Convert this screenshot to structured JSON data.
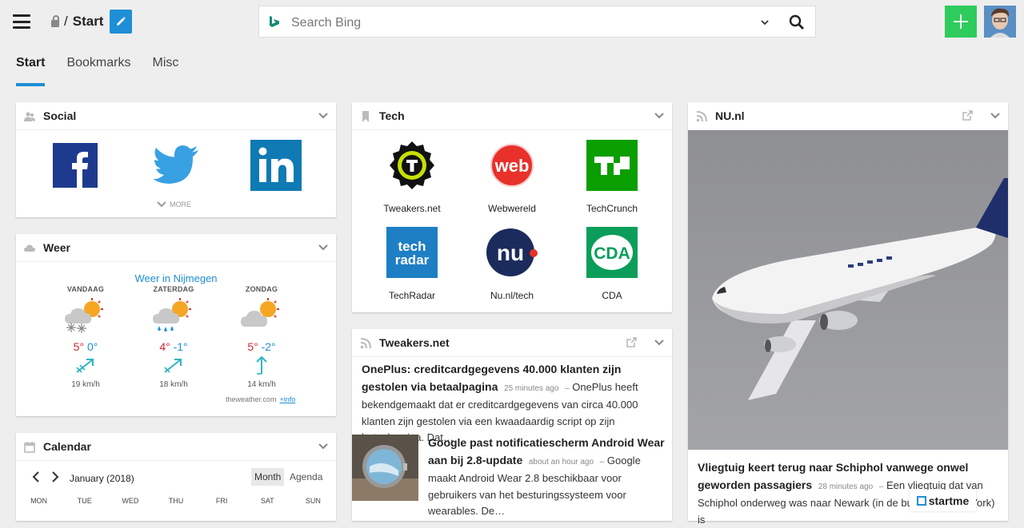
{
  "header": {
    "breadcrumb_sep": "/",
    "page_title": "Start",
    "search_placeholder": "Search Bing"
  },
  "tabs": [
    {
      "label": "Start",
      "active": true
    },
    {
      "label": "Bookmarks",
      "active": false
    },
    {
      "label": "Misc",
      "active": false
    }
  ],
  "social": {
    "title": "Social",
    "icons": [
      "facebook-icon",
      "twitter-icon",
      "linkedin-icon"
    ],
    "more_label": "MORE"
  },
  "weather": {
    "title": "Weer",
    "location": "Weer in Nijmegen",
    "days": [
      {
        "name": "VANDAAG",
        "hi": "5°",
        "lo": "0°",
        "wind": "19 km/h",
        "icon": "snow-sun-cloud-icon"
      },
      {
        "name": "ZATERDAG",
        "hi": "4°",
        "lo": "-1°",
        "wind": "18 km/h",
        "icon": "rain-sun-cloud-icon"
      },
      {
        "name": "ZONDAG",
        "hi": "5°",
        "lo": "-2°",
        "wind": "14 km/h",
        "icon": "sun-cloud-icon"
      }
    ],
    "source": "theweather.com",
    "info_link": "+info"
  },
  "calendar": {
    "title": "Calendar",
    "month": "January (2018)",
    "view_month": "Month",
    "view_agenda": "Agenda",
    "dow": [
      "MON",
      "TUE",
      "WED",
      "THU",
      "FRI",
      "SAT",
      "SUN"
    ]
  },
  "tech": {
    "title": "Tech",
    "tiles": [
      {
        "label": "Tweakers.net"
      },
      {
        "label": "Webwereld"
      },
      {
        "label": "TechCrunch"
      },
      {
        "label": "TechRadar"
      },
      {
        "label": "Nu.nl/tech"
      },
      {
        "label": "CDA"
      }
    ]
  },
  "tweakers": {
    "title": "Tweakers.net",
    "items": [
      {
        "headline": "OnePlus: creditcardgegevens 40.000 klanten zijn gestolen via betaalpagina",
        "ago": "25 minutes ago",
        "sep": "–",
        "summary": "OnePlus heeft bekendgemaakt dat er creditcardgegevens van circa 40.000 klanten zijn gestolen via een kwaadaardig script op zijn betaalpagina. Dat…"
      },
      {
        "headline": "Google past notificatiescherm Android Wear aan bij 2.8-update",
        "ago": "about an hour ago",
        "sep": "–",
        "summary": "Google maakt Android Wear 2.8 beschikbaar voor gebruikers van het besturingssysteem voor wearables. De…"
      }
    ]
  },
  "nu": {
    "title": "NU.nl",
    "headline": "Vliegtuig keert terug naar Schiphol vanwege onwel geworden passagiers",
    "ago": "28 minutes ago",
    "sep": "–",
    "summary": "Een vliegtuig dat van Schiphol onderweg was naar Newark (in de buurt van New York) is"
  },
  "badge": {
    "label": "startme"
  },
  "colors": {
    "accent": "#1e8fd6",
    "add": "#2ecc5c",
    "hi_temp": "#d8262e"
  }
}
